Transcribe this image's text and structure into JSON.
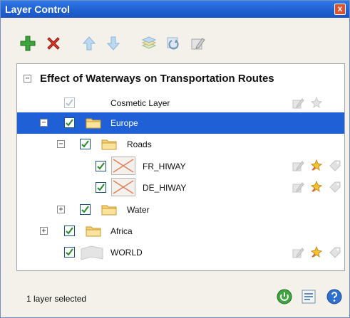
{
  "window": {
    "title": "Layer Control",
    "close_glyph": "x"
  },
  "toolbar": {
    "buttons": [
      {
        "icon": "add-icon"
      },
      {
        "icon": "delete-icon"
      },
      {
        "icon": "move-up-icon"
      },
      {
        "icon": "move-down-icon"
      },
      {
        "icon": "layer-properties-icon"
      },
      {
        "icon": "refresh-layer-icon"
      },
      {
        "icon": "edit-style-icon"
      }
    ]
  },
  "tree": {
    "root": {
      "label": "Effect of Waterways on Transportation Routes",
      "expander": "−"
    },
    "rows": {
      "cosmetic": {
        "label": "Cosmetic Layer"
      },
      "europe": {
        "label": "Europe",
        "expander": "−"
      },
      "roads": {
        "label": "Roads",
        "expander": "−"
      },
      "fr_hiway": {
        "label": "FR_HIWAY"
      },
      "de_hiway": {
        "label": "DE_HIWAY"
      },
      "water": {
        "label": "Water",
        "expander": "+"
      },
      "africa": {
        "label": "Africa",
        "expander": "+"
      },
      "world": {
        "label": "WORLD"
      }
    }
  },
  "status": {
    "text": "1 layer selected"
  },
  "colors": {
    "selection": "#1f60d6",
    "titlebar": "#1f5fd0",
    "check": "#2a8a2a"
  }
}
